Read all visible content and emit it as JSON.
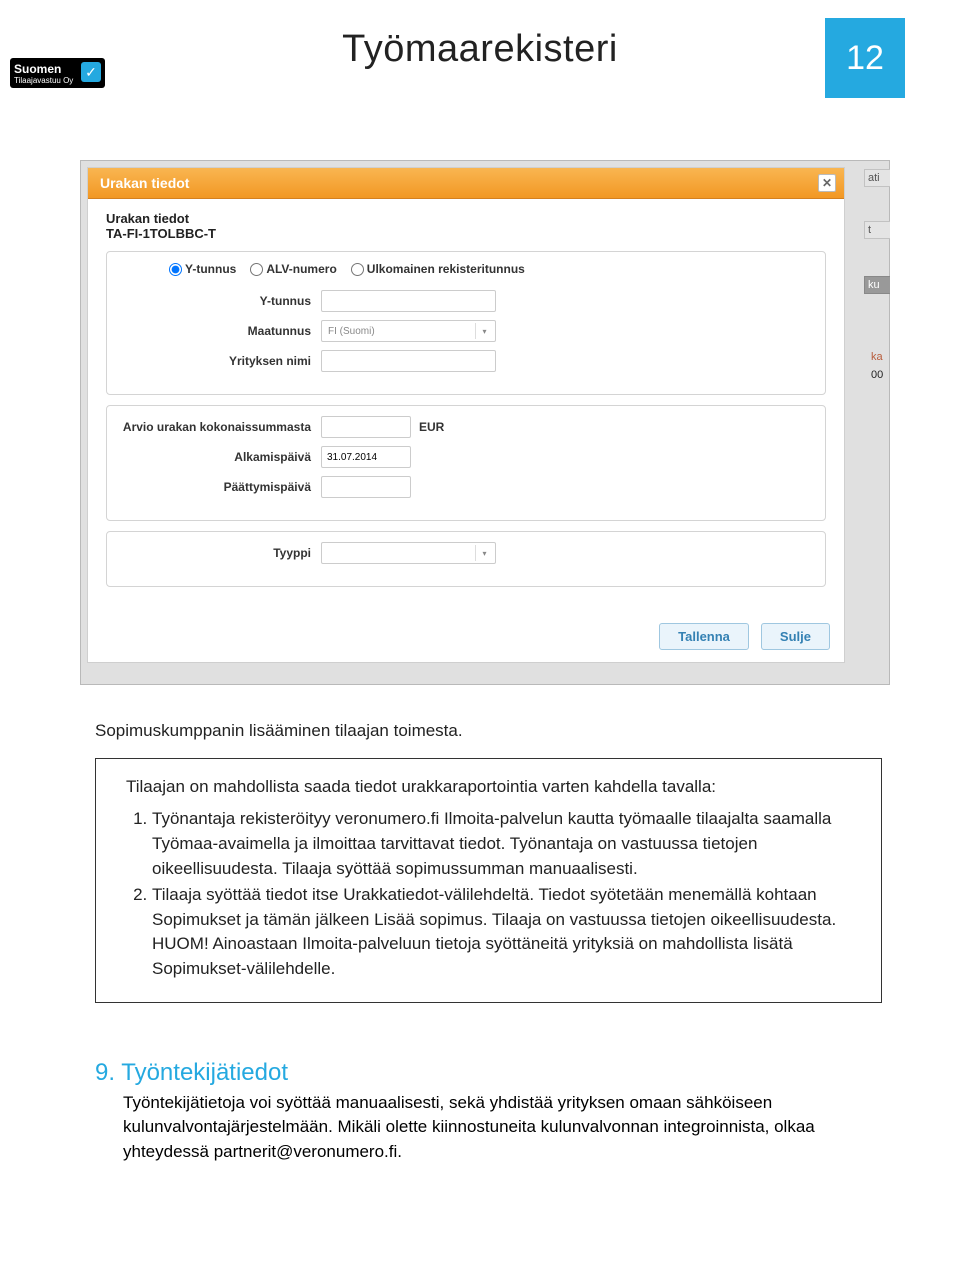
{
  "header": {
    "logo": {
      "primary": "Suomen",
      "sub": "Tilaajavastuu Oy"
    },
    "title": "Työmaarekisteri",
    "page_number": "12"
  },
  "screenshot": {
    "bg": {
      "tab1": "ati",
      "tab2": "t",
      "tab3": "ku",
      "red": "ka",
      "black": "00"
    },
    "dialog": {
      "title": "Urakan tiedot",
      "close_symbol": "✕",
      "subtitle": "Urakan tiedot",
      "subcode": "TA-FI-1TOLBBC-T",
      "radios": {
        "opt1": "Y-tunnus",
        "opt2": "ALV-numero",
        "opt3": "Ulkomainen rekisteritunnus"
      },
      "labels": {
        "ytunnus": "Y-tunnus",
        "maatunnus": "Maatunnus",
        "maatunnus_value": "FI (Suomi)",
        "yritys": "Yrityksen nimi",
        "arvio": "Arvio urakan kokonaissummasta",
        "currency": "EUR",
        "alku": "Alkamispäivä",
        "alku_value": "31.07.2014",
        "loppu": "Päättymispäivä",
        "tyyppi": "Tyyppi"
      },
      "buttons": {
        "save": "Tallenna",
        "close": "Sulje"
      }
    }
  },
  "body": {
    "caption": "Sopimuskumppanin lisääminen tilaajan toimesta.",
    "intro": "Tilaajan on mahdollista saada tiedot urakkaraportointia varten kahdella tavalla:",
    "item1": "Työnantaja rekisteröityy veronumero.fi Ilmoita-palvelun kautta työmaalle tilaajalta saamalla Työmaa-avaimella ja ilmoittaa tarvittavat tiedot. Työnantaja on vastuussa tietojen oikeellisuudesta. Tilaaja syöttää sopimussumman manuaalisesti.",
    "item2": "Tilaaja syöttää tiedot itse Urakkatiedot-välilehdeltä. Tiedot syötetään menemällä kohtaan Sopimukset ja tämän jälkeen Lisää sopimus. Tilaaja on vastuussa tietojen oikeellisuudesta. HUOM! Ainoastaan Ilmoita-palveluun tietoja syöttäneitä yrityksiä on mahdollista lisätä Sopimukset-välilehdelle."
  },
  "section9": {
    "heading": "9. Työntekijätiedot",
    "text": "Työntekijätietoja voi syöttää manuaalisesti, sekä yhdistää yrityksen omaan sähköiseen kulunvalvontajärjestelmään. Mikäli olette kiinnostuneita kulunvalvonnan integroinnista, olkaa yhteydessä partnerit@veronumero.fi."
  }
}
